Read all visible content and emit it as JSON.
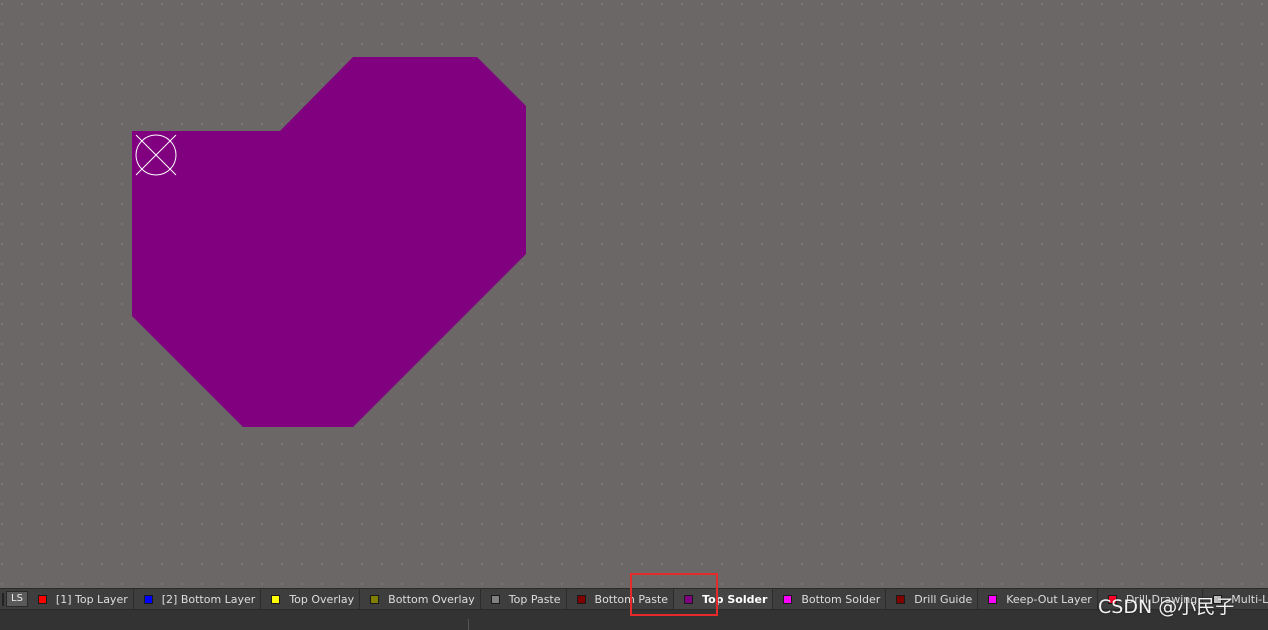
{
  "canvas": {
    "background_color": "#6b6766",
    "board_shape_color": "#800080",
    "marker_icon": "crosshair-circle-icon"
  },
  "layer_bar": {
    "current_layer_color": "#800080",
    "ls_label": "LS",
    "layers": [
      {
        "label": "[1] Top Layer",
        "color": "#ff0000",
        "active": false
      },
      {
        "label": "[2] Bottom Layer",
        "color": "#0000ff",
        "active": false
      },
      {
        "label": "Top Overlay",
        "color": "#ffff00",
        "active": false
      },
      {
        "label": "Bottom Overlay",
        "color": "#808000",
        "active": false
      },
      {
        "label": "Top Paste",
        "color": "#808080",
        "active": false
      },
      {
        "label": "Bottom Paste",
        "color": "#800000",
        "active": false
      },
      {
        "label": "Top Solder",
        "color": "#800080",
        "active": true
      },
      {
        "label": "Bottom Solder",
        "color": "#ff00ff",
        "active": false
      },
      {
        "label": "Drill Guide",
        "color": "#800000",
        "active": false
      },
      {
        "label": "Keep-Out Layer",
        "color": "#ff00ff",
        "active": false
      },
      {
        "label": "Drill Drawing",
        "color": "#ff002a",
        "active": false
      },
      {
        "label": "Multi-Layer",
        "color": "#c0c0c0",
        "active": false
      }
    ]
  },
  "highlight_color": "#e52a2a",
  "watermark": "CSDN @小民子"
}
